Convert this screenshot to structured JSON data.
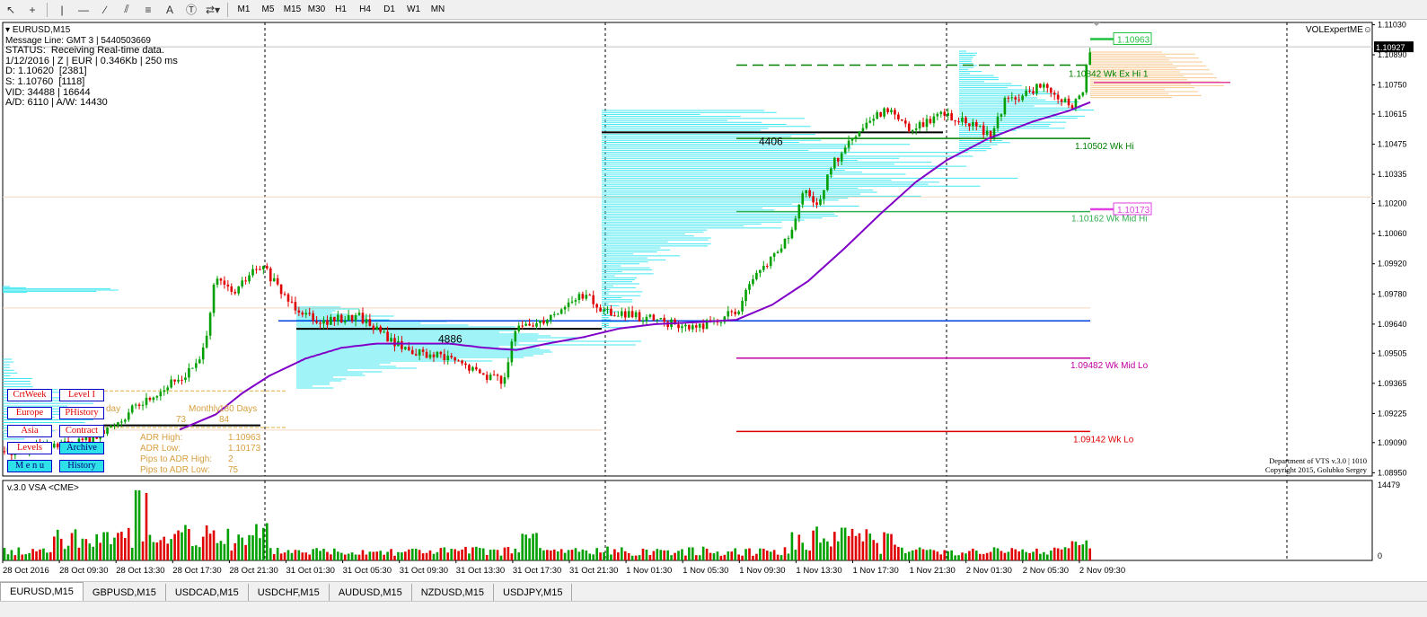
{
  "toolbar": {
    "timeframes": [
      "M1",
      "M5",
      "M15",
      "M30",
      "H1",
      "H4",
      "D1",
      "W1",
      "MN"
    ]
  },
  "info": {
    "symbol": "EURUSD,M15",
    "message_line": "Message Line: GMT 3 | 5440503669",
    "status": "STATUS:  Receiving Real-time data.",
    "line1": "1/12/2016 | Z | EUR | 0.346Kb | 250 ms",
    "line2": "D: 1.10620  [2381]",
    "line3": "S: 1.10760  [1118]",
    "line4": "VID: 34488 | 16644",
    "line5": "A/D: 6110 | A/W: 14430"
  },
  "indicator_name": "VOLExpertME",
  "copyright": {
    "line1": "Department of VTS  v.3.0 | 1010",
    "line2": "Copyright 2015, Golubko Sergey"
  },
  "vsa": {
    "label": "v.3.0 VSA <CME>",
    "max": "14479",
    "zero": "0"
  },
  "price_axis": [
    "1.11030",
    "1.10890",
    "1.10750",
    "1.10615",
    "1.10475",
    "1.10335",
    "1.10200",
    "1.10060",
    "1.09920",
    "1.09780",
    "1.09640",
    "1.09505",
    "1.09365",
    "1.09225",
    "1.09090",
    "1.08950"
  ],
  "current_price": "1.10927",
  "time_axis": [
    "28 Oct 2016",
    "28 Oct 09:30",
    "28 Oct 13:30",
    "28 Oct 17:30",
    "28 Oct 21:30",
    "31 Oct 01:30",
    "31 Oct 05:30",
    "31 Oct 09:30",
    "31 Oct 13:30",
    "31 Oct 17:30",
    "31 Oct 21:30",
    "1 Nov 01:30",
    "1 Nov 05:30",
    "1 Nov 09:30",
    "1 Nov 13:30",
    "1 Nov 17:30",
    "1 Nov 21:30",
    "2 Nov 01:30",
    "2 Nov 05:30",
    "2 Nov 09:30"
  ],
  "levels": {
    "wk_ex_hi": "1.10842  Wk Ex Hi 1",
    "wk_hi": "1.10502  Wk Hi",
    "wk_mid_hi": "1.10162  Wk Mid Hi",
    "wk_mid_lo": "1.09482  Wk Mid Lo",
    "wk_lo": "1.09142  Wk Lo",
    "tag_high": "1.10963",
    "tag_mid": "1.10173",
    "poc1": "4886",
    "poc2": "4406"
  },
  "panel": {
    "btn_crtweek": "CrtWeek",
    "btn_level": "Level I",
    "btn_europe": "Europe",
    "btn_phistory": "PHistory",
    "btn_asia": "Asia",
    "btn_contract": "Contract",
    "btn_levels": "Levels",
    "btn_archive": "Archive",
    "btn_menu": "M e n u",
    "btn_history": "History",
    "stat_day": "day",
    "stat_monthly": "Monthly",
    "stat_180": "180 Days",
    "stat_n1": "73",
    "stat_n2": "84",
    "stat_adrhigh_label": "ADR High:",
    "stat_adrhigh": "1.10963",
    "stat_adrlow_label": "ADR Low:",
    "stat_adrlow": "1.10173",
    "stat_pips_hi_label": "Pips to ADR High:",
    "stat_pips_hi": "2",
    "stat_pips_lo_label": "Pips to ADR Low:",
    "stat_pips_lo": "75"
  },
  "tabs": [
    "EURUSD,M15",
    "GBPUSD,M15",
    "USDCAD,M15",
    "USDCHF,M15",
    "AUDUSD,M15",
    "NZDUSD,M15",
    "USDJPY,M15"
  ],
  "colors": {
    "bull": "#00a000",
    "bear": "#e00000",
    "profile": "#40e8f0",
    "ma": "#8000c8",
    "wk_hi": "#008000",
    "wk_mid": "#c000a0",
    "wk_lo": "#e00000",
    "poc_line": "#0040e0"
  }
}
